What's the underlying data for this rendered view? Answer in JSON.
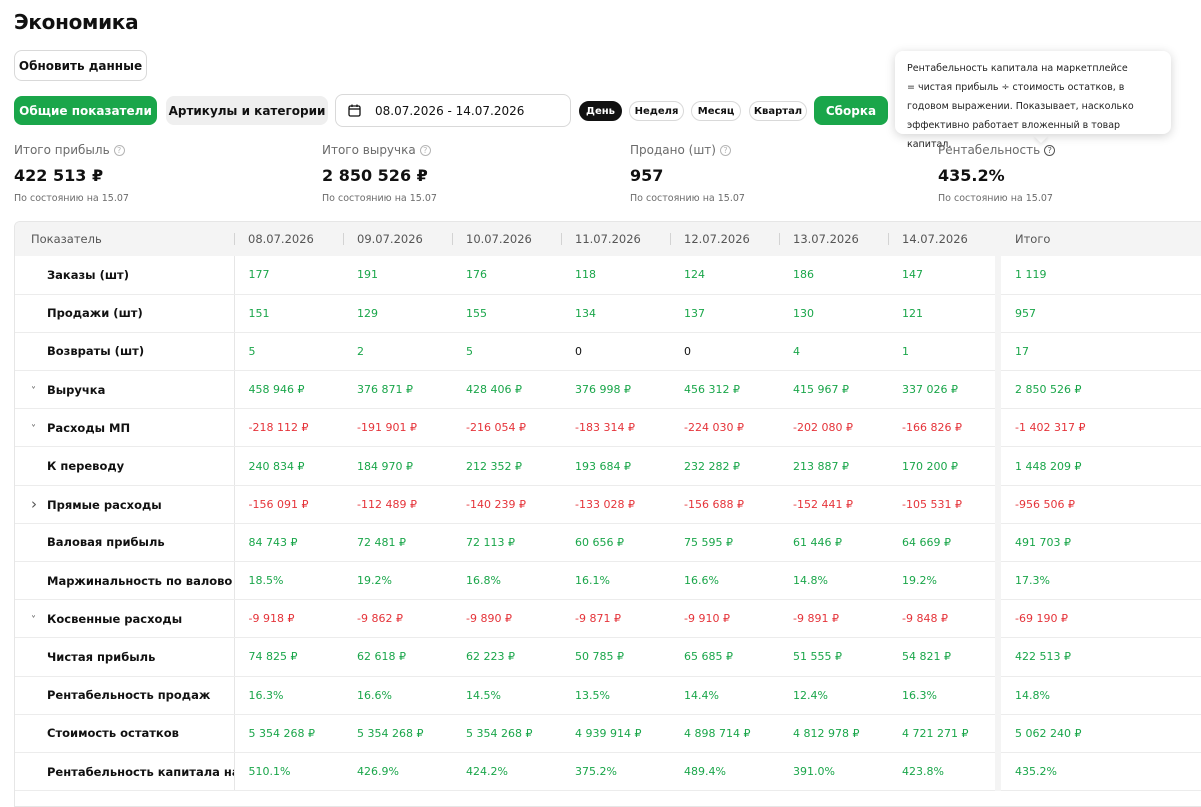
{
  "page": {
    "title": "Экономика",
    "refresh_label": "Обновить данные",
    "tabs": [
      "Общие показатели",
      "Артикулы и категории"
    ],
    "date_range": "08.07.2026 - 14.07.2026",
    "periods": [
      "День",
      "Неделя",
      "Месяц",
      "Квартал"
    ],
    "active_period": "День",
    "assemble_label": "Сборка"
  },
  "tooltip": {
    "lines": [
      "Рентабельность капитала на маркетплейсе",
      "= чистая прибыль ÷ стоимость остатков, в",
      "годовом выражении. Показывает, насколько",
      "эффективно работает вложенный в товар капитал."
    ]
  },
  "kpis": [
    {
      "label": "Итого прибыль",
      "value": "422 513 ₽",
      "note": "По состоянию на 15.07"
    },
    {
      "label": "Итого выручка",
      "value": "2 850 526 ₽",
      "note": "По состоянию на 15.07"
    },
    {
      "label": "Продано (шт)",
      "value": "957",
      "note": "По состоянию на 15.07"
    },
    {
      "label": "Рентабельность",
      "value": "435.2%",
      "note": "По состоянию на 15.07"
    }
  ],
  "table": {
    "headers": [
      "Показатель",
      "08.07.2026",
      "09.07.2026",
      "10.07.2026",
      "11.07.2026",
      "12.07.2026",
      "13.07.2026",
      "14.07.2026",
      "Итого"
    ],
    "rows": [
      {
        "label": "Заказы (шт)",
        "expand": "",
        "values": [
          "177",
          "191",
          "176",
          "118",
          "124",
          "186",
          "147",
          "1 119"
        ],
        "colors": [
          "g",
          "g",
          "g",
          "g",
          "g",
          "g",
          "g",
          "g"
        ]
      },
      {
        "label": "Продажи (шт)",
        "expand": "",
        "values": [
          "151",
          "129",
          "155",
          "134",
          "137",
          "130",
          "121",
          "957"
        ],
        "colors": [
          "g",
          "g",
          "g",
          "g",
          "g",
          "g",
          "g",
          "g"
        ]
      },
      {
        "label": "Возвраты (шт)",
        "expand": "",
        "values": [
          "5",
          "2",
          "5",
          "0",
          "0",
          "4",
          "1",
          "17"
        ],
        "colors": [
          "g",
          "g",
          "g",
          "n",
          "n",
          "g",
          "g",
          "g"
        ]
      },
      {
        "label": "Выручка",
        "expand": "down",
        "values": [
          "458 946 ₽",
          "376 871 ₽",
          "428 406 ₽",
          "376 998 ₽",
          "456 312 ₽",
          "415 967 ₽",
          "337 026 ₽",
          "2 850 526 ₽"
        ],
        "colors": [
          "g",
          "g",
          "g",
          "g",
          "g",
          "g",
          "g",
          "g"
        ]
      },
      {
        "label": "Расходы МП",
        "expand": "down",
        "values": [
          "-218 112 ₽",
          "-191 901 ₽",
          "-216 054 ₽",
          "-183 314 ₽",
          "-224 030 ₽",
          "-202 080 ₽",
          "-166 826 ₽",
          "-1 402 317 ₽"
        ],
        "colors": [
          "r",
          "r",
          "r",
          "r",
          "r",
          "r",
          "r",
          "r"
        ]
      },
      {
        "label": "К переводу",
        "expand": "",
        "values": [
          "240 834 ₽",
          "184 970 ₽",
          "212 352 ₽",
          "193 684 ₽",
          "232 282 ₽",
          "213 887 ₽",
          "170 200 ₽",
          "1 448 209 ₽"
        ],
        "colors": [
          "g",
          "g",
          "g",
          "g",
          "g",
          "g",
          "g",
          "g"
        ]
      },
      {
        "label": "Прямые расходы",
        "expand": "right",
        "values": [
          "-156 091 ₽",
          "-112 489 ₽",
          "-140 239 ₽",
          "-133 028 ₽",
          "-156 688 ₽",
          "-152 441 ₽",
          "-105 531 ₽",
          "-956 506 ₽"
        ],
        "colors": [
          "r",
          "r",
          "r",
          "r",
          "r",
          "r",
          "r",
          "r"
        ]
      },
      {
        "label": "Валовая прибыль",
        "expand": "",
        "values": [
          "84 743 ₽",
          "72 481 ₽",
          "72 113 ₽",
          "60 656 ₽",
          "75 595 ₽",
          "61 446 ₽",
          "64 669 ₽",
          "491 703 ₽"
        ],
        "colors": [
          "g",
          "g",
          "g",
          "g",
          "g",
          "g",
          "g",
          "g"
        ]
      },
      {
        "label": "Маржинальность по валово",
        "expand": "",
        "values": [
          "18.5%",
          "19.2%",
          "16.8%",
          "16.1%",
          "16.6%",
          "14.8%",
          "19.2%",
          "17.3%"
        ],
        "colors": [
          "g",
          "g",
          "g",
          "g",
          "g",
          "g",
          "g",
          "g"
        ]
      },
      {
        "label": "Косвенные расходы",
        "expand": "down",
        "values": [
          "-9 918 ₽",
          "-9 862 ₽",
          "-9 890 ₽",
          "-9 871 ₽",
          "-9 910 ₽",
          "-9 891 ₽",
          "-9 848 ₽",
          "-69 190 ₽"
        ],
        "colors": [
          "r",
          "r",
          "r",
          "r",
          "r",
          "r",
          "r",
          "r"
        ]
      },
      {
        "label": "Чистая прибыль",
        "expand": "",
        "values": [
          "74 825 ₽",
          "62 618 ₽",
          "62 223 ₽",
          "50 785 ₽",
          "65 685 ₽",
          "51 555 ₽",
          "54 821 ₽",
          "422 513 ₽"
        ],
        "colors": [
          "g",
          "g",
          "g",
          "g",
          "g",
          "g",
          "g",
          "g"
        ]
      },
      {
        "label": "Рентабельность продаж",
        "expand": "",
        "values": [
          "16.3%",
          "16.6%",
          "14.5%",
          "13.5%",
          "14.4%",
          "12.4%",
          "16.3%",
          "14.8%"
        ],
        "colors": [
          "g",
          "g",
          "g",
          "g",
          "g",
          "g",
          "g",
          "g"
        ]
      },
      {
        "label": "Стоимость остатков",
        "expand": "",
        "values": [
          "5 354 268 ₽",
          "5 354 268 ₽",
          "5 354 268 ₽",
          "4 939 914 ₽",
          "4 898 714 ₽",
          "4 812 978 ₽",
          "4 721 271 ₽",
          "5 062 240 ₽"
        ],
        "colors": [
          "g",
          "g",
          "g",
          "g",
          "g",
          "g",
          "g",
          "g"
        ]
      },
      {
        "label": "Рентабельность капитала на",
        "expand": "",
        "values": [
          "510.1%",
          "426.9%",
          "424.2%",
          "375.2%",
          "489.4%",
          "391.0%",
          "423.8%",
          "435.2%"
        ],
        "colors": [
          "g",
          "g",
          "g",
          "g",
          "g",
          "g",
          "g",
          "g"
        ]
      }
    ]
  },
  "colors": {
    "accent": "#1aa64a",
    "negative": "#e5343a",
    "header_bg": "#f4f4f4"
  }
}
